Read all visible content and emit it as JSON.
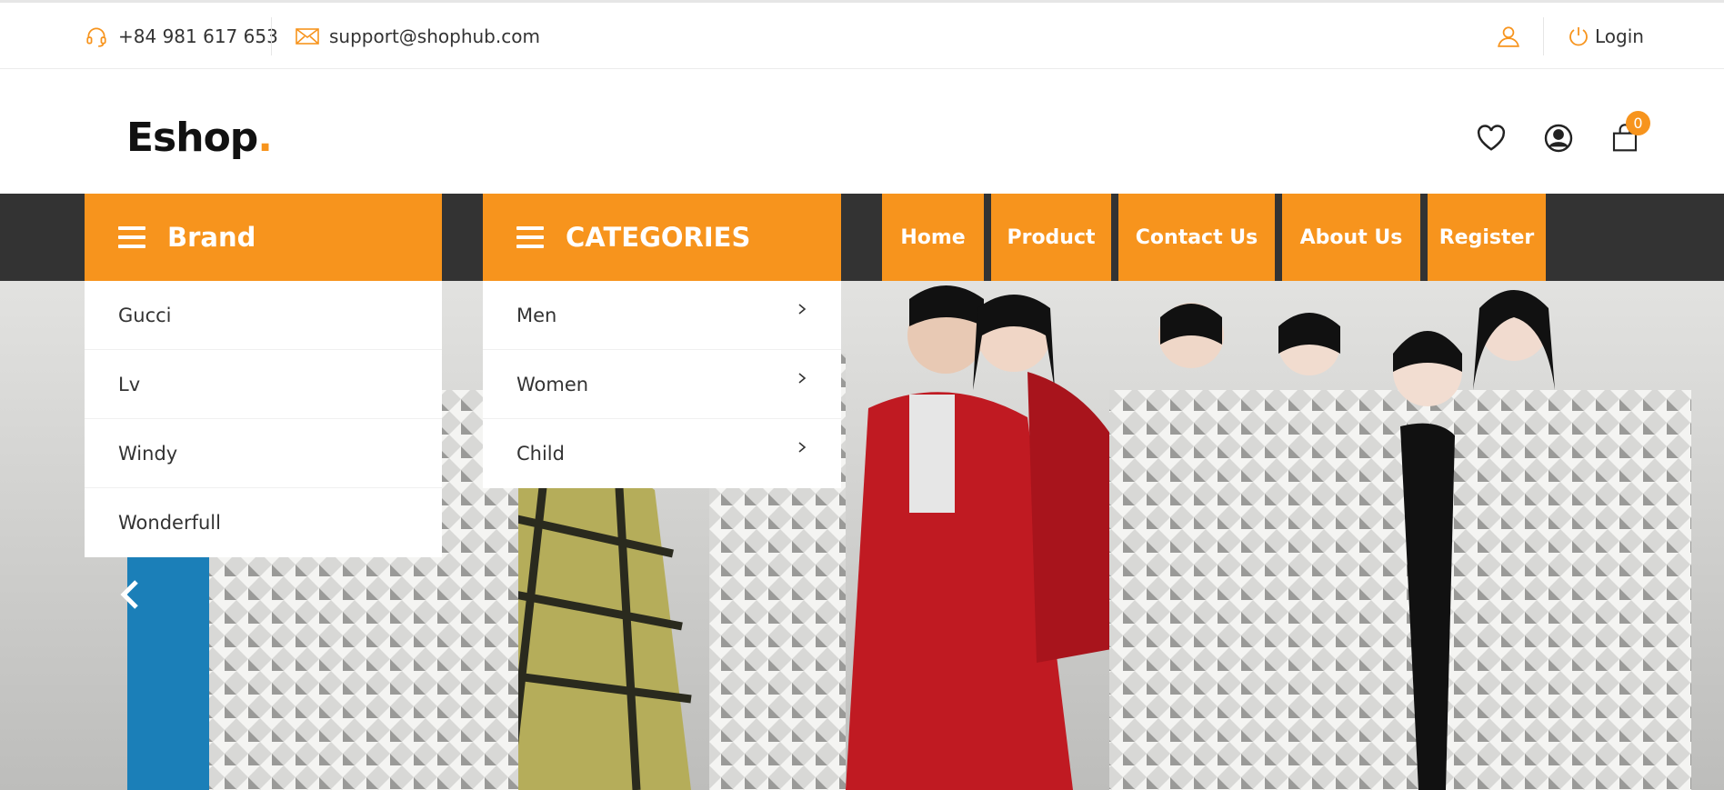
{
  "topbar": {
    "phone": "+84 981 617 653",
    "email": "support@shophub.com",
    "login_label": "Login"
  },
  "header": {
    "logo_text": "Eshop",
    "logo_dot": ".",
    "cart_count": "0"
  },
  "nav": {
    "brand_title": "Brand",
    "categories_title": "CATEGORIES",
    "menu": [
      "Home",
      "Product",
      "Contact Us",
      "About Us",
      "Register"
    ]
  },
  "brands": [
    "Gucci",
    "Lv",
    "Windy",
    "Wonderfull"
  ],
  "categories": [
    "Men",
    "Women",
    "Child"
  ],
  "colors": {
    "accent": "#f7941d",
    "nav_dark": "#333333"
  },
  "icons": {
    "phone": "headset-icon",
    "email": "mail-icon",
    "user": "user-icon",
    "login": "power-icon",
    "wishlist": "heart-icon",
    "account": "account-circle-icon",
    "cart": "shopping-bag-icon",
    "menu": "hamburger-icon",
    "submenu": "chevron-right-icon",
    "slider_prev": "chevron-left-icon"
  }
}
